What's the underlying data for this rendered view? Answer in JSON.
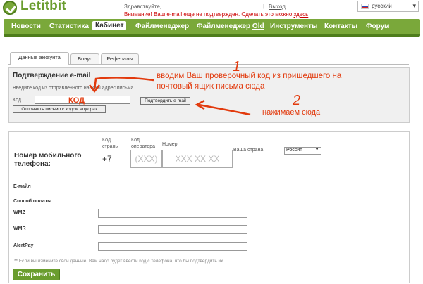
{
  "header": {
    "logo_text": "Letitbit",
    "greeting": "Здравствуйте,",
    "logout_sep": "|",
    "logout": "Выход",
    "warning": "Внимание! Ваш e-mail еще не подтвержден. Сделать это можно",
    "warning_link": "здесь",
    "language": "русский"
  },
  "nav": {
    "items": [
      {
        "label": "Новости"
      },
      {
        "label": "Статистика"
      },
      {
        "label": "Кабинет",
        "active": true
      },
      {
        "label": "Файлменеджер"
      },
      {
        "label": "Файлменеджер",
        "suffix": "Old"
      },
      {
        "label": "Инструменты"
      },
      {
        "label": "Контакты"
      },
      {
        "label": "Форум"
      }
    ]
  },
  "tabs": [
    "Данные аккаунта",
    "Бонус",
    "Рефералы"
  ],
  "email_confirm": {
    "title": "Подтверждение e-mail",
    "hint": "Введите код из отправленного на Ваш адрес письма",
    "code_label": "Код",
    "confirm_button": "Подтвердить e-mail",
    "resend_button": "Отправить письмо с кодом еще раз"
  },
  "annotations": {
    "num1": "1",
    "line1": "вводим Ваш проверочный код из пришедшего на",
    "line2": "почтовый ящик письма сюда",
    "kod": "КОД",
    "num2": "2",
    "click_here": "нажимаем сюда"
  },
  "phone": {
    "title": "Номер мобильного телефона:",
    "country_code_label": "Код страны",
    "operator_code_label": "Код оператора",
    "number_label": "Номер",
    "country_code_value": "+7",
    "operator_placeholder": "(XXX)",
    "number_placeholder": "XXX XX XX",
    "country_label": "Ваша страна",
    "country_value": "Россия"
  },
  "form": {
    "email_label": "E-майл",
    "payment_label": "Способ оплаты:",
    "wmz_label": "WMZ",
    "wmr_label": "WMR",
    "alertpay_label": "AlertPay",
    "footnote": "** Если вы измените свои данные. Вам надо будет ввести код с телефона, что бы подтвердить их.",
    "save_button": "Сохранить"
  },
  "colors": {
    "brand_green": "#7aa83a",
    "brand_dark_green": "#4e7d1c",
    "annotation_red": "#e23a0d",
    "warning_red": "#cc0000"
  }
}
